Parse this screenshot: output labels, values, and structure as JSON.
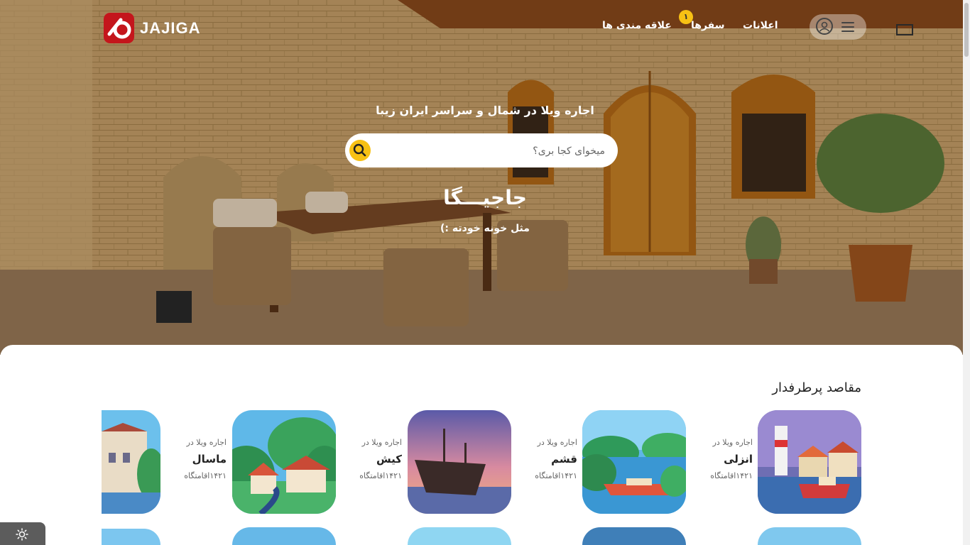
{
  "brand": {
    "logo_text": "JAJIGA",
    "accent": "#c4161c"
  },
  "nav": {
    "announcements": "اعلانات",
    "trips": "سفرها",
    "trips_badge": "۱",
    "favorites": "علاقه مندی ها"
  },
  "hero": {
    "tagline": "اجاره ویلا در شمال و سراسر ایران زیبا",
    "search_placeholder": "میخوای کجا بری؟",
    "brand_title": "جاجیـــگا",
    "brand_subtitle": "مثل خونه خودته :)"
  },
  "section": {
    "title": "مقاصد پرطرفدار"
  },
  "destinations": [
    {
      "prefix": "اجاره ویلا در",
      "city": "انزلی",
      "count": "۱۴۲۱اقامتگاه",
      "icon": "lighthouse-harbor-illustration"
    },
    {
      "prefix": "اجاره ویلا در",
      "city": "قشم",
      "count": "۱۴۲۱اقامتگاه",
      "icon": "speedboat-lake-illustration"
    },
    {
      "prefix": "اجاره ویلا در",
      "city": "کیش",
      "count": "۱۴۲۱اقامتگاه",
      "icon": "ship-sunset-illustration"
    },
    {
      "prefix": "اجاره ویلا در",
      "city": "ماسال",
      "count": "۱۴۲۱اقامتگاه",
      "icon": "village-hill-illustration"
    }
  ],
  "colors": {
    "yellow": "#f7c114",
    "text": "#222222"
  }
}
